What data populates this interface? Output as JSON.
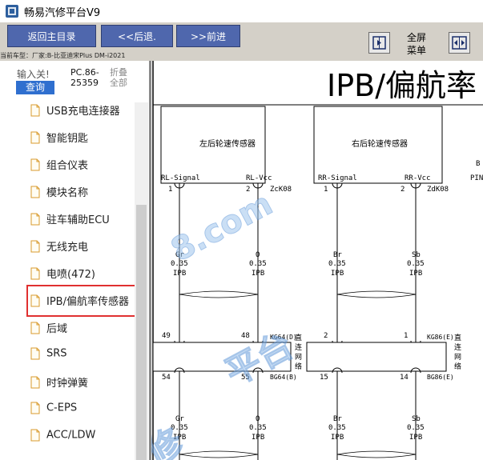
{
  "window": {
    "title": "畅易汽修平台V9"
  },
  "toolbar": {
    "home_label": "返回主目录",
    "back_label": "<<后退.",
    "forward_label": ">>前进",
    "vehicle_prefix": "当前车型：",
    "vehicle_value": "厂家:B-比亚迪宋Plus DM-i2021",
    "fullscreen_line1": "全屏",
    "fullscreen_line2": "菜单"
  },
  "sidebar": {
    "search_label": "输入关!",
    "search_button": "查询",
    "code_line1": "PC.86-",
    "code_line2": "25359",
    "collapse_line1": "折叠",
    "collapse_line2": "全部",
    "items": [
      {
        "label": "USB充电连接器"
      },
      {
        "label": "智能钥匙"
      },
      {
        "label": "组合仪表"
      },
      {
        "label": "模块名称"
      },
      {
        "label": "驻车辅助ECU"
      },
      {
        "label": "无线充电"
      },
      {
        "label": "电喷(472)"
      },
      {
        "label": "IPB/偏航率传感器"
      },
      {
        "label": "后域"
      },
      {
        "label": "SRS"
      },
      {
        "label": "时钟弹簧"
      },
      {
        "label": "C-EPS"
      },
      {
        "label": "ACC/LDW"
      }
    ],
    "selected_index": 7
  },
  "diagram": {
    "title": "IPB/偏航率",
    "left_sensor": "左后轮速传感器",
    "right_sensor": "右后轮速传感器",
    "rl_signal": "RL-Signal",
    "rl_vcc": "RL-Vcc",
    "rr_signal": "RR-Signal",
    "rr_vcc": "RR-Vcc",
    "zk08": "ZcK08",
    "zdk08": "ZdK08",
    "pin1": "1",
    "pin2": "2",
    "pin49": "49",
    "pin48": "48",
    "pin2b": "2",
    "pin1b": "1",
    "pin54": "54",
    "pin55": "55",
    "pin15": "15",
    "pin14": "14",
    "kg64": "KG64(D)",
    "kg86": "KG86(E)",
    "bg64": "BG64(B)",
    "bg86": "BG86(E)",
    "direct_text": "直连网络",
    "wire_gr": "Gr",
    "wire_o": "O",
    "wire_br": "Br",
    "wire_sb": "Sb",
    "gauge": "0.35",
    "ipb": "IPB",
    "edge_b": "B",
    "edge_pin": "PIN",
    "watermark_1": "8.com",
    "watermark_2": "平台",
    "watermark_3": "修"
  }
}
